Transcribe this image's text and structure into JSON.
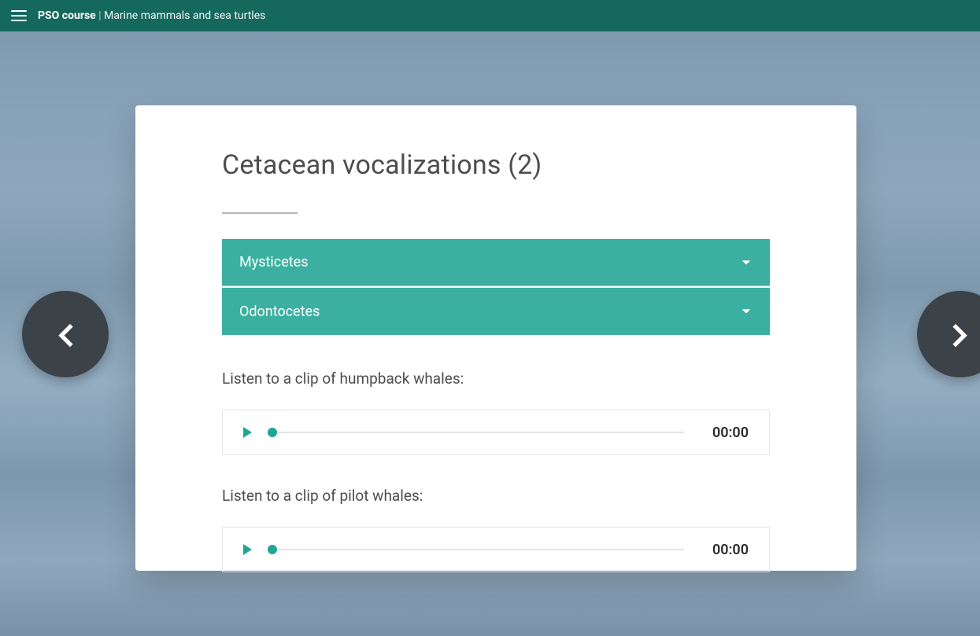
{
  "header": {
    "course_title": "PSO course",
    "divider": "|",
    "section_title": "Marine mammals and sea turtles"
  },
  "nav": {
    "prev_label": "Previous slide",
    "next_label": "Next slide"
  },
  "card": {
    "title": "Cetacean vocalizations (2)",
    "accordion": [
      {
        "label": "Mysticetes"
      },
      {
        "label": "Odontocetes"
      }
    ],
    "clips": [
      {
        "prompt": "Listen to a clip of humpback whales:",
        "time": "00:00"
      },
      {
        "prompt": "Listen to a clip of pilot whales:",
        "time": "00:00"
      }
    ]
  },
  "colors": {
    "brand_dark": "#15685c",
    "accent": "#3bb0a0",
    "accent_strong": "#1fa696",
    "nav_bg": "#3b4248",
    "text": "#4d4d4d"
  }
}
